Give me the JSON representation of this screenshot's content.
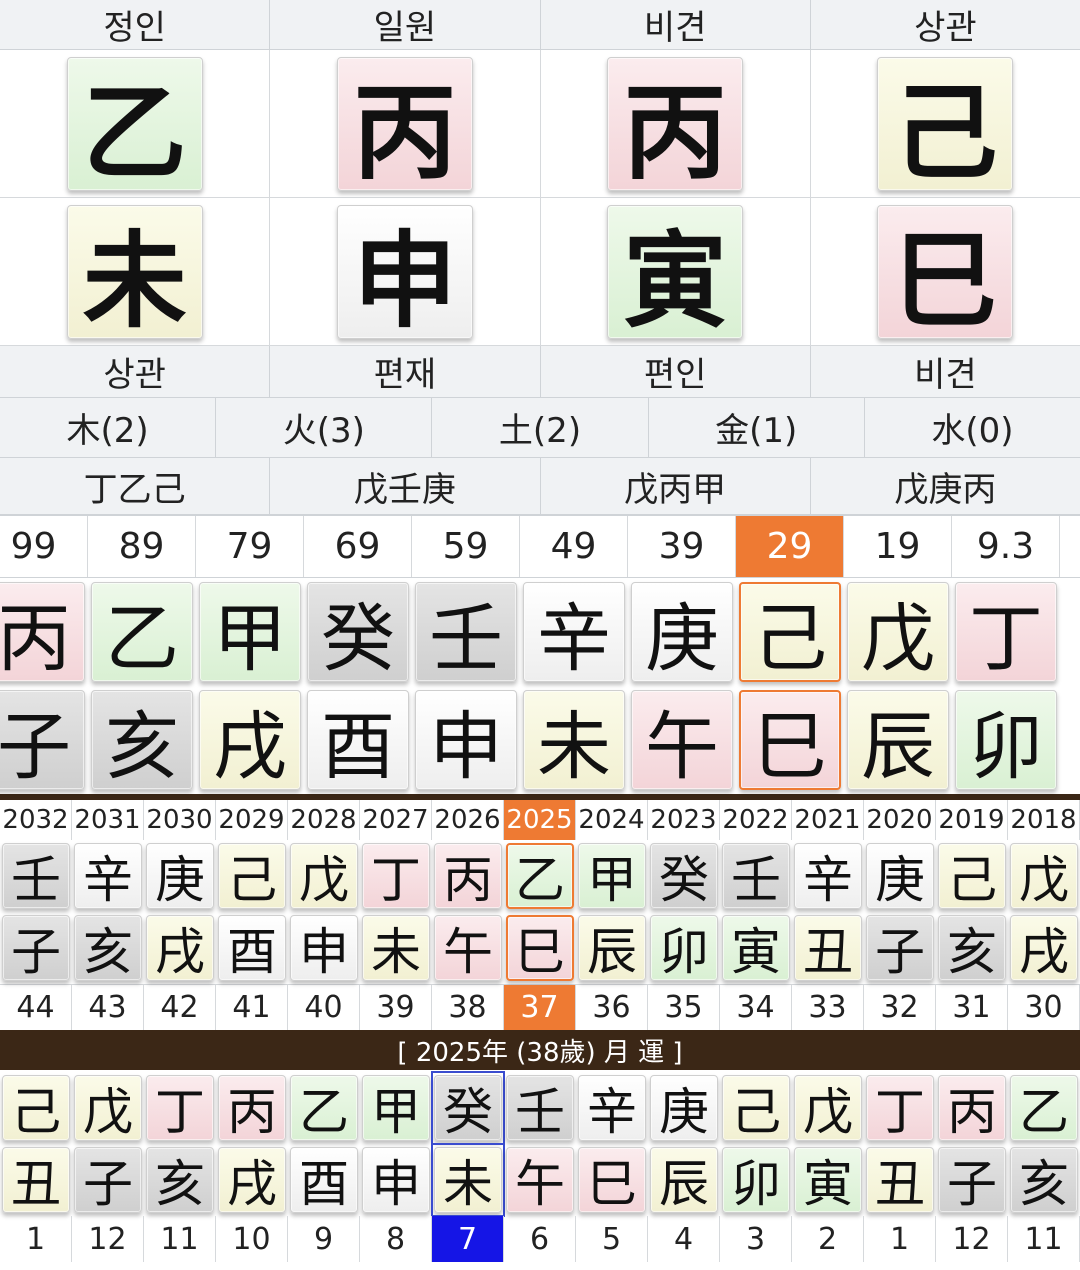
{
  "pillars": {
    "top_labels": [
      "정인",
      "일원",
      "비견",
      "상관"
    ],
    "stems": [
      {
        "char": "乙",
        "color": "green"
      },
      {
        "char": "丙",
        "color": "pink"
      },
      {
        "char": "丙",
        "color": "pink"
      },
      {
        "char": "己",
        "color": "yellow"
      }
    ],
    "branches": [
      {
        "char": "未",
        "color": "yellow"
      },
      {
        "char": "申",
        "color": "white"
      },
      {
        "char": "寅",
        "color": "green"
      },
      {
        "char": "巳",
        "color": "pink"
      }
    ],
    "bottom_labels": [
      "상관",
      "편재",
      "편인",
      "비견"
    ]
  },
  "elements": [
    "木(2)",
    "火(3)",
    "土(2)",
    "金(1)",
    "水(0)"
  ],
  "hidden_stems": [
    "丁乙己",
    "戊壬庚",
    "戊丙甲",
    "戊庚丙"
  ],
  "daeun": {
    "ages": [
      "99",
      "89",
      "79",
      "69",
      "59",
      "49",
      "39",
      "29",
      "19",
      "9.3"
    ],
    "selected_index": 7,
    "stems": [
      {
        "char": "丙",
        "color": "pink"
      },
      {
        "char": "乙",
        "color": "green"
      },
      {
        "char": "甲",
        "color": "green"
      },
      {
        "char": "癸",
        "color": "gray"
      },
      {
        "char": "壬",
        "color": "gray"
      },
      {
        "char": "辛",
        "color": "white"
      },
      {
        "char": "庚",
        "color": "white"
      },
      {
        "char": "己",
        "color": "yellow"
      },
      {
        "char": "戊",
        "color": "yellow"
      },
      {
        "char": "丁",
        "color": "pink"
      }
    ],
    "branches": [
      {
        "char": "子",
        "color": "gray"
      },
      {
        "char": "亥",
        "color": "gray"
      },
      {
        "char": "戌",
        "color": "yellow"
      },
      {
        "char": "酉",
        "color": "white"
      },
      {
        "char": "申",
        "color": "white"
      },
      {
        "char": "未",
        "color": "yellow"
      },
      {
        "char": "午",
        "color": "pink"
      },
      {
        "char": "巳",
        "color": "pink"
      },
      {
        "char": "辰",
        "color": "yellow"
      },
      {
        "char": "卯",
        "color": "green"
      }
    ]
  },
  "seun": {
    "years": [
      "2032",
      "2031",
      "2030",
      "2029",
      "2028",
      "2027",
      "2026",
      "2025",
      "2024",
      "2023",
      "2022",
      "2021",
      "2020",
      "2019",
      "2018"
    ],
    "selected_index": 7,
    "stems": [
      {
        "char": "壬",
        "color": "gray"
      },
      {
        "char": "辛",
        "color": "white"
      },
      {
        "char": "庚",
        "color": "white"
      },
      {
        "char": "己",
        "color": "yellow"
      },
      {
        "char": "戊",
        "color": "yellow"
      },
      {
        "char": "丁",
        "color": "pink"
      },
      {
        "char": "丙",
        "color": "pink"
      },
      {
        "char": "乙",
        "color": "green"
      },
      {
        "char": "甲",
        "color": "green"
      },
      {
        "char": "癸",
        "color": "gray"
      },
      {
        "char": "壬",
        "color": "gray"
      },
      {
        "char": "辛",
        "color": "white"
      },
      {
        "char": "庚",
        "color": "white"
      },
      {
        "char": "己",
        "color": "yellow"
      },
      {
        "char": "戊",
        "color": "yellow"
      }
    ],
    "branches": [
      {
        "char": "子",
        "color": "gray"
      },
      {
        "char": "亥",
        "color": "gray"
      },
      {
        "char": "戌",
        "color": "yellow"
      },
      {
        "char": "酉",
        "color": "white"
      },
      {
        "char": "申",
        "color": "white"
      },
      {
        "char": "未",
        "color": "yellow"
      },
      {
        "char": "午",
        "color": "pink"
      },
      {
        "char": "巳",
        "color": "pink"
      },
      {
        "char": "辰",
        "color": "yellow"
      },
      {
        "char": "卯",
        "color": "green"
      },
      {
        "char": "寅",
        "color": "green"
      },
      {
        "char": "丑",
        "color": "yellow"
      },
      {
        "char": "子",
        "color": "gray"
      },
      {
        "char": "亥",
        "color": "gray"
      },
      {
        "char": "戌",
        "color": "yellow"
      }
    ],
    "ages": [
      "44",
      "43",
      "42",
      "41",
      "40",
      "39",
      "38",
      "37",
      "36",
      "35",
      "34",
      "33",
      "32",
      "31",
      "30"
    ]
  },
  "month_title": "[ 2025年 (38歲) 月 運 ]",
  "wolun": {
    "selected_index": 6,
    "stems": [
      {
        "char": "己",
        "color": "yellow"
      },
      {
        "char": "戊",
        "color": "yellow"
      },
      {
        "char": "丁",
        "color": "pink"
      },
      {
        "char": "丙",
        "color": "pink"
      },
      {
        "char": "乙",
        "color": "green"
      },
      {
        "char": "甲",
        "color": "green"
      },
      {
        "char": "癸",
        "color": "gray"
      },
      {
        "char": "壬",
        "color": "gray"
      },
      {
        "char": "辛",
        "color": "white"
      },
      {
        "char": "庚",
        "color": "white"
      },
      {
        "char": "己",
        "color": "yellow"
      },
      {
        "char": "戊",
        "color": "yellow"
      },
      {
        "char": "丁",
        "color": "pink"
      },
      {
        "char": "丙",
        "color": "pink"
      },
      {
        "char": "乙",
        "color": "green"
      }
    ],
    "branches": [
      {
        "char": "丑",
        "color": "yellow"
      },
      {
        "char": "子",
        "color": "gray"
      },
      {
        "char": "亥",
        "color": "gray"
      },
      {
        "char": "戌",
        "color": "yellow"
      },
      {
        "char": "酉",
        "color": "white"
      },
      {
        "char": "申",
        "color": "white"
      },
      {
        "char": "未",
        "color": "yellow"
      },
      {
        "char": "午",
        "color": "pink"
      },
      {
        "char": "巳",
        "color": "pink"
      },
      {
        "char": "辰",
        "color": "yellow"
      },
      {
        "char": "卯",
        "color": "green"
      },
      {
        "char": "寅",
        "color": "green"
      },
      {
        "char": "丑",
        "color": "yellow"
      },
      {
        "char": "子",
        "color": "gray"
      },
      {
        "char": "亥",
        "color": "gray"
      }
    ],
    "months": [
      "1",
      "12",
      "11",
      "10",
      "9",
      "8",
      "7",
      "6",
      "5",
      "4",
      "3",
      "2",
      "1",
      "12",
      "11"
    ]
  },
  "colors": {
    "selected_orange": "#ee7a33",
    "selected_blue": "#1515e6",
    "bar_brown": "#3b2716"
  }
}
